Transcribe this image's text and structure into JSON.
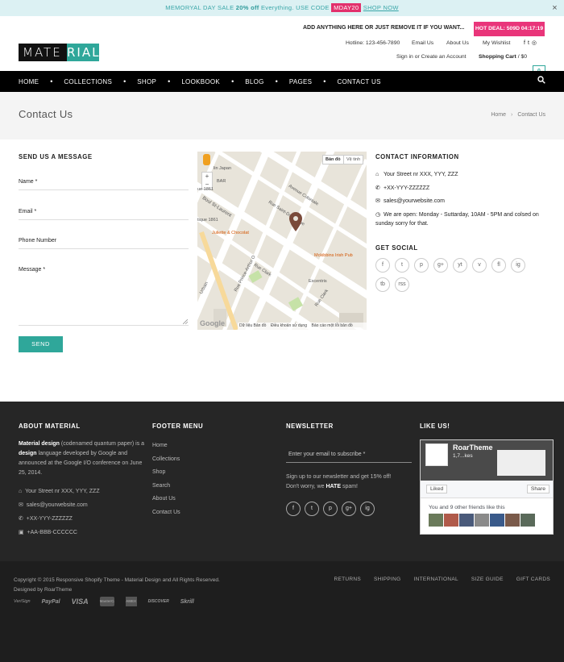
{
  "promo": {
    "text_before": "MEMORYAL DAY SALE ",
    "bold": "20% off",
    "text_mid": " Everything. USE CODE ",
    "code": "MDAY20",
    "shop": "SHOP NOW",
    "close": "×"
  },
  "header": {
    "logo_part1": "MATE",
    "logo_part2": "RIAL",
    "message": "ADD ANYTHING HERE OR JUST REMOVE IT IF YOU WANT...",
    "hot_deal": "HOT DEAL: 509D 04:17:19",
    "hotline": "Hotline: 123-456-7890",
    "email_us": "Email Us",
    "about_us": "About Us",
    "wishlist": "My Wishlist",
    "social": [
      "f",
      "t",
      "ig"
    ],
    "sign_in": "Sign in",
    "or": "or",
    "create_account": "Create an Account",
    "cart_label": "Shopping Cart",
    "cart_sep": "/",
    "cart_total": "$0",
    "cart_count": "0"
  },
  "nav": {
    "items": [
      "HOME",
      "COLLECTIONS",
      "SHOP",
      "LOOKBOOK",
      "BLOG",
      "PAGES",
      "CONTACT US"
    ],
    "dot": "•",
    "search_icon": "search-icon"
  },
  "page": {
    "title": "Contact Us",
    "breadcrumb_home": "Home",
    "breadcrumb_sep": "›",
    "breadcrumb_current": "Contact Us"
  },
  "form": {
    "heading": "SEND US A MESSAGE",
    "name": "Name *",
    "email": "Email *",
    "phone": "Phone Number",
    "message": "Message *",
    "send": "SEND"
  },
  "map": {
    "btn_map": "Bản đồ",
    "btn_sat": "Vệ tinh",
    "zoom_in": "+",
    "zoom_out": "−",
    "labels": {
      "juliette": "Juliette & Chocolat",
      "mckibbins": "Mckibbins Irish Pub",
      "excentris": "Excentris",
      "avenue_coloniale": "Avenue Coloniale",
      "boul_st_laurent": "Boul St-Laurent",
      "rue_saint_dominique": "Rue Saint-Dominique",
      "rue_clark": "Rue Clark",
      "rue_prince_arthur": "Rue Prince-Arthur O",
      "urbain": "Urbain",
      "le_1861": "tique 1861",
      "le_2": "ue 1861",
      "in_japan": "lin Japan",
      "bar": "BAR"
    },
    "footer_data": "Dữ liệu Bản đồ",
    "footer_terms": "Điều khoản sử dụng",
    "footer_report": "Báo cáo một lỗi bản đồ",
    "google": "Google"
  },
  "contact": {
    "heading": "CONTACT INFORMATION",
    "address": "Your Street nr XXX, YYY, ZZZ",
    "phone": "+XX-YYY-ZZZZZZ",
    "email": "sales@yourwebsite.com",
    "hours": "We are open: Monday - Suttarday, 10AM - 5PM and colsed on sunday sorry for that.",
    "social_heading": "GET SOCIAL",
    "social_icons": [
      "f",
      "t",
      "p",
      "g+",
      "yt",
      "v",
      "fl",
      "ig",
      "tb",
      "rss"
    ]
  },
  "footer": {
    "about_heading": "ABOUT MATERIAL",
    "about_b1": "Material design",
    "about_t1": " (codenamed quantum paper) is a ",
    "about_b2": "design",
    "about_t2": " language developed by Google and announced at the Google I/O conference on June 25, 2014.",
    "address": "Your Street nr XXX, YYY, ZZZ",
    "email": "sales@yourwebsite.com",
    "phone1": "+XX-YYY-ZZZZZZ",
    "phone2": "+AA-BBB-CCCCCC",
    "menu_heading": "FOOTER MENU",
    "menu": [
      "Home",
      "Collections",
      "Shop",
      "Search",
      "About Us",
      "Contact Us"
    ],
    "newsletter_heading": "NEWSLETTER",
    "newsletter_placeholder": "Enter your email to subscribe *",
    "newsletter_text1": "Sign up to our newsletter and get 15% off! Don't worry, we ",
    "newsletter_hate": "HATE",
    "newsletter_text2": " spam!",
    "newsletter_social": [
      "f",
      "t",
      "p",
      "g+",
      "ig"
    ],
    "like_heading": "LIKE US!",
    "fb_name": "RoarTheme",
    "fb_likes": "1,7...kes",
    "fb_liked": "Liked",
    "fb_share": "Share",
    "fb_friends": "You and 9 other friends like this"
  },
  "bottom": {
    "copyright": "Copyright © 2015 Responsive Shopify Theme - Material Design and All Rights Reserved.",
    "designed": "Designed by RoarTheme",
    "links": [
      "RETURNS",
      "SHIPPING",
      "INTERNATIONAL",
      "SIZE GUIDE",
      "GIFT CARDS"
    ],
    "payments": [
      "VeriSign",
      "PayPal",
      "VISA",
      "MasterCard",
      "AMEX",
      "DISCOVER",
      "Skrill"
    ]
  }
}
